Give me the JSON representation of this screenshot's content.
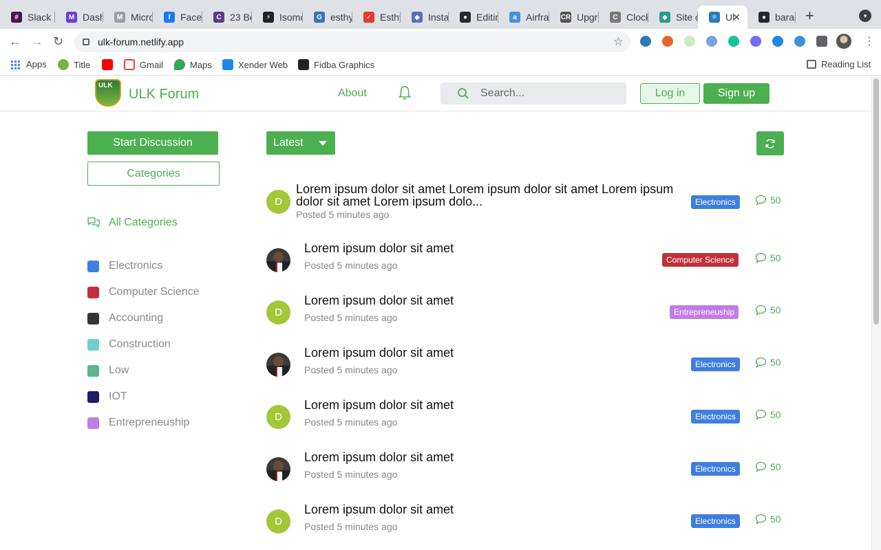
{
  "browser": {
    "tabs": [
      {
        "label": "Slack",
        "color": "#4a154b",
        "glyph": "#"
      },
      {
        "label": "Dashb",
        "color": "#6c3bd6",
        "glyph": "M"
      },
      {
        "label": "Micro",
        "color": "#9aa0a6",
        "glyph": "M"
      },
      {
        "label": "Faceb",
        "color": "#1877f2",
        "glyph": "f"
      },
      {
        "label": "23 Be",
        "color": "#5b3c8a",
        "glyph": "C"
      },
      {
        "label": "Isomo",
        "color": "#202124",
        "glyph": "⚡"
      },
      {
        "label": "esthy",
        "color": "#3c6fb4",
        "glyph": "G"
      },
      {
        "label": "Esthy",
        "color": "#e53935",
        "glyph": "✓"
      },
      {
        "label": "Instal",
        "color": "#5c6bc0",
        "glyph": "◆"
      },
      {
        "label": "Editin",
        "color": "#24292e",
        "glyph": "●"
      },
      {
        "label": "Airfra",
        "color": "#4a90d9",
        "glyph": "a"
      },
      {
        "label": "Upgra",
        "color": "#555555",
        "glyph": "CR"
      },
      {
        "label": "Clock",
        "color": "#777777",
        "glyph": "C"
      },
      {
        "label": "Site o",
        "color": "#2b9c8c",
        "glyph": "◆"
      },
      {
        "label": "Ul",
        "color": "#2b7bb9",
        "glyph": "⚛",
        "active": true
      },
      {
        "label": "barac",
        "color": "#24292e",
        "glyph": "●"
      }
    ],
    "url": "ulk-forum.netlify.app",
    "bookmarks": [
      {
        "label": "Apps"
      },
      {
        "label": "Title",
        "color": "#7cb342"
      },
      {
        "label": "",
        "color": "#ff0000"
      },
      {
        "label": "Gmail",
        "color": "#ea4335"
      },
      {
        "label": "Maps",
        "color": "#34a853"
      },
      {
        "label": "Xender Web",
        "color": "#1e88e5"
      },
      {
        "label": "Fidba Graphics",
        "color": "#222222"
      }
    ],
    "reading_list": "Reading List"
  },
  "header": {
    "logo_text": "ULK",
    "brand": "ULK Forum",
    "about": "About",
    "search_placeholder": "Search...",
    "login": "Log in",
    "signup": "Sign up"
  },
  "sidebar": {
    "start_discussion": "Start Discussion",
    "categories": "Categories",
    "all_categories": "All Categories",
    "items": [
      {
        "label": "Electronics",
        "color": "#3f7ee0"
      },
      {
        "label": "Computer Science",
        "color": "#c0313b"
      },
      {
        "label": "Accounting",
        "color": "#333639"
      },
      {
        "label": "Construction",
        "color": "#6dcfd0"
      },
      {
        "label": "Low",
        "color": "#5db48d"
      },
      {
        "label": "IOT",
        "color": "#1f1a66"
      },
      {
        "label": "Entrepreneuship",
        "color": "#c07de8"
      }
    ]
  },
  "main": {
    "sort": "Latest",
    "threads": [
      {
        "avatar": "D",
        "title_line1": "Lorem ipsum dolor sit amet Lorem ipsum dolor sit amet Lorem ipsum",
        "title_line2": "dolor sit amet Lorem ipsum dolo...",
        "meta": "Posted 5 minutes ago",
        "category": "Electronics",
        "category_color": "#3f7ee0",
        "replies": "50"
      },
      {
        "avatar": "",
        "title_line1": "Lorem ipsum dolor sit amet",
        "meta": "Posted 5 minutes ago",
        "category": "Computer Science",
        "category_color": "#c0313b",
        "replies": "50"
      },
      {
        "avatar": "D",
        "title_line1": "Lorem ipsum dolor sit amet",
        "meta": "Posted 5 minutes ago",
        "category": "Entrepreneuship",
        "category_color": "#c07de8",
        "replies": "50"
      },
      {
        "avatar": "",
        "title_line1": "Lorem ipsum dolor sit amet",
        "meta": "Posted 5 minutes ago",
        "category": "Electronics",
        "category_color": "#3f7ee0",
        "replies": "50"
      },
      {
        "avatar": "D",
        "title_line1": "Lorem ipsum dolor sit amet",
        "meta": "Posted 5 minutes ago",
        "category": "Electronics",
        "category_color": "#3f7ee0",
        "replies": "50"
      },
      {
        "avatar": "",
        "title_line1": "Lorem ipsum dolor sit amet",
        "meta": "Posted 5 minutes ago",
        "category": "Electronics",
        "category_color": "#3f7ee0",
        "replies": "50"
      },
      {
        "avatar": "D",
        "title_line1": "Lorem ipsum dolor sit amet",
        "meta": "Posted 5 minutes ago",
        "category": "Electronics",
        "category_color": "#3f7ee0",
        "replies": "50"
      }
    ]
  }
}
